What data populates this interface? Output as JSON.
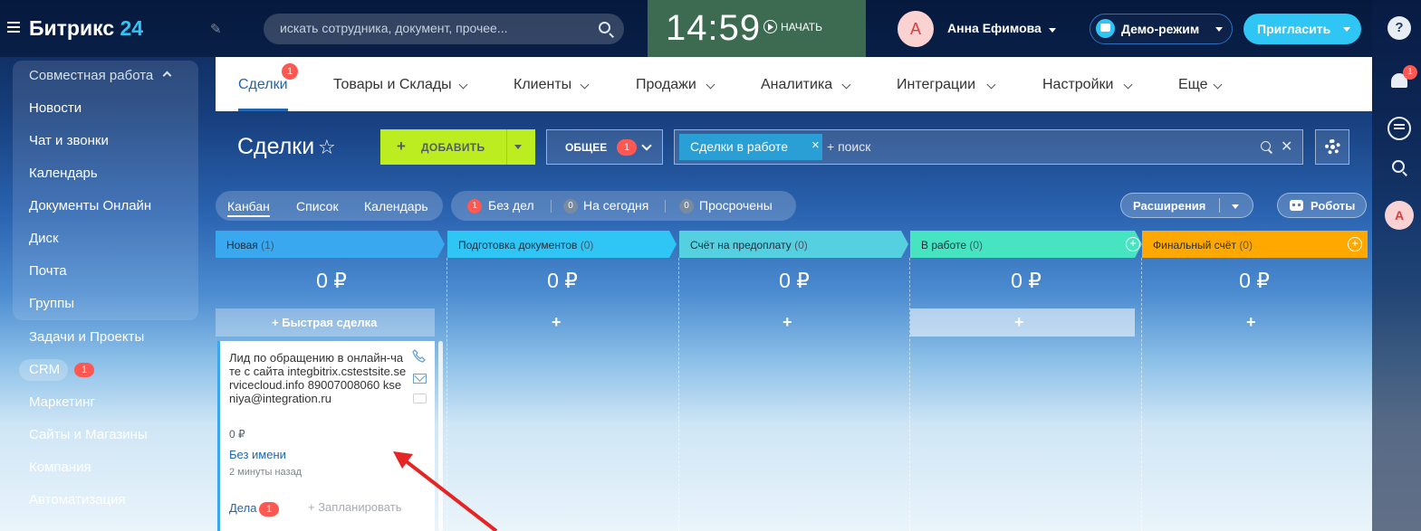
{
  "app": {
    "logo_name": "Битрикс",
    "logo_number": "24"
  },
  "topbar": {
    "search_placeholder": "искать сотрудника, документ, прочее...",
    "clock_time": "14:59",
    "start_label": "НАЧАТЬ",
    "avatar_letter": "А",
    "user_name": "Анна Ефимова",
    "demo_label": "Демо-режим",
    "invite_label": "Пригласить"
  },
  "rightrail": {
    "help": "?",
    "notifications_badge": "1",
    "avatar_letter": "А"
  },
  "sidebar": {
    "group_title": "Совместная работа",
    "group_items": [
      "Новости",
      "Чат и звонки",
      "Календарь",
      "Документы Онлайн",
      "Диск",
      "Почта",
      "Группы"
    ],
    "items": [
      "Задачи и Проекты",
      "CRM",
      "Маркетинг",
      "Сайты и Магазины",
      "Компания",
      "Автоматизация"
    ],
    "crm_badge": "1"
  },
  "menu": {
    "items": [
      "Сделки",
      "Товары и Склады",
      "Клиенты",
      "Продажи",
      "Аналитика",
      "Интеграции",
      "Настройки",
      "Еще"
    ],
    "active_badge": "1"
  },
  "toolbar": {
    "page_title": "Сделки",
    "add_label": "ДОБАВИТЬ",
    "general_label": "ОБЩЕЕ",
    "general_badge": "1",
    "filter_chip": "Сделки в работе",
    "filter_placeholder": "+ поиск"
  },
  "views": {
    "kanban": "Канбан",
    "list": "Список",
    "calendar": "Календарь"
  },
  "counters": [
    {
      "count": "1",
      "label": "Без дел",
      "color": "#ff5752"
    },
    {
      "count": "0",
      "label": "На сегодня",
      "color": "#7a8aa0"
    },
    {
      "count": "0",
      "label": "Просрочены",
      "color": "#7a8aa0"
    }
  ],
  "extensions_label": "Расширения",
  "robots_label": "Роботы",
  "stages": [
    {
      "name": "Новая",
      "count": "(1)",
      "sum": "0 ₽",
      "color": "#39a8ef"
    },
    {
      "name": "Подготовка документов",
      "count": "(0)",
      "sum": "0 ₽",
      "color": "#2fc6f6"
    },
    {
      "name": "Счёт на предоплату",
      "count": "(0)",
      "sum": "0 ₽",
      "color": "#55d0e0"
    },
    {
      "name": "В работе",
      "count": "(0)",
      "sum": "0 ₽",
      "color": "#47e4c2"
    },
    {
      "name": "Финальный счёт",
      "count": "(0)",
      "sum": "0 ₽",
      "color": "#ffa900"
    }
  ],
  "quick_deal_label": "Быстрая сделка",
  "card": {
    "title": "Лид по обращению в онлайн-чате с сайта integbitrix.cstestsite.servicecloud.info 89007008060 kseniya@integration.ru",
    "sum": "0 ₽",
    "client": "Без имени",
    "time": "2 минуты назад",
    "tasks_label": "Дела",
    "tasks_badge": "1",
    "plan_label": "+ Запланировать"
  },
  "colors": {
    "accent": "#2fc6f6",
    "add_button": "#bbed21",
    "badge": "#ff5752",
    "link": "#2067b0"
  }
}
